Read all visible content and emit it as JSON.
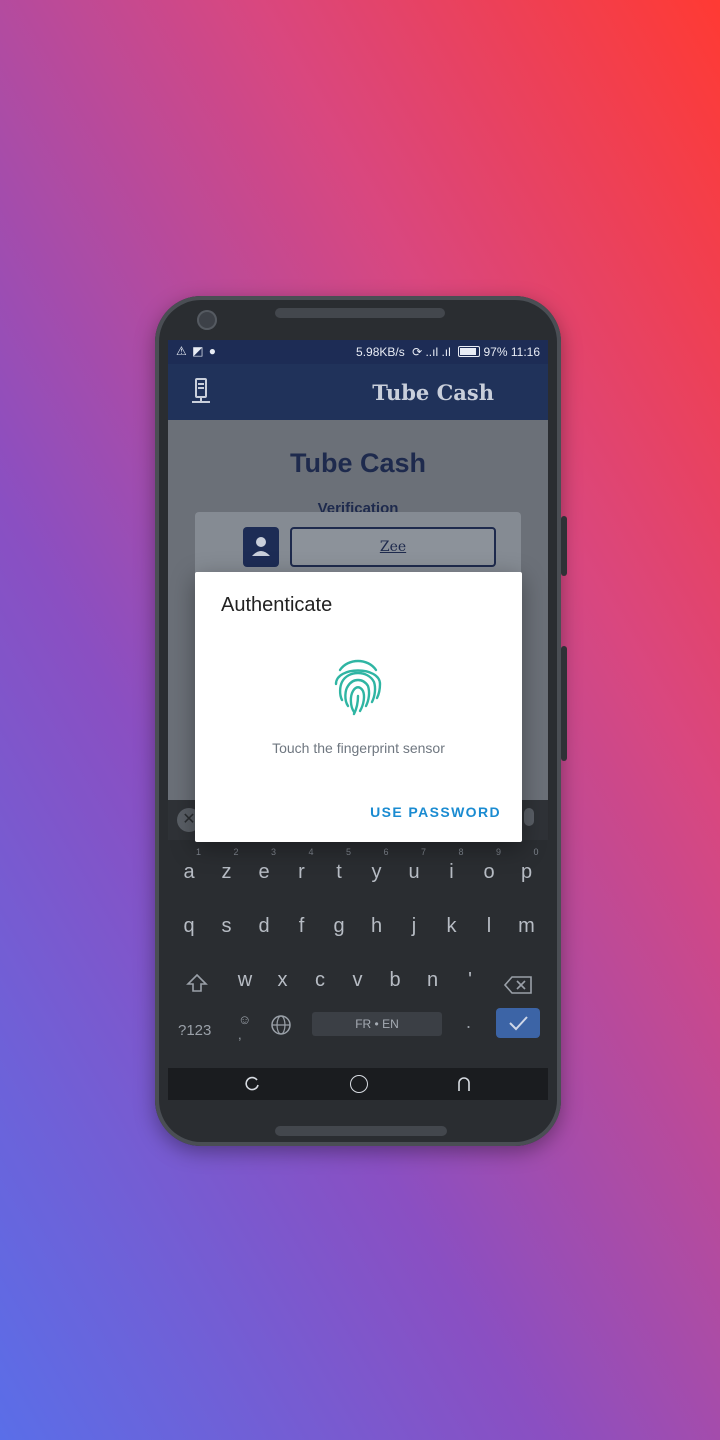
{
  "status_bar": {
    "left_icons": "⚠ ◩ ●",
    "speed": "5.98KB/s",
    "battery": "97%",
    "time": "11:16"
  },
  "app_bar": {
    "title": "Tube Cash",
    "menu_icon": "server-icon"
  },
  "page": {
    "title": "Tube Cash",
    "subtitle": "Verification",
    "username_value": "Zee"
  },
  "dialog": {
    "title": "Authenticate",
    "message": "Touch the fingerprint sensor",
    "button": "USE PASSWORD",
    "accent": "#1a8bd1",
    "fingerprint_color": "#2fb5a3"
  },
  "keyboard": {
    "row1": [
      [
        "a",
        "1"
      ],
      [
        "z",
        "2"
      ],
      [
        "e",
        "3"
      ],
      [
        "r",
        "4"
      ],
      [
        "t",
        "5"
      ],
      [
        "y",
        "6"
      ],
      [
        "u",
        "7"
      ],
      [
        "i",
        "8"
      ],
      [
        "o",
        "9"
      ],
      [
        "p",
        "0"
      ]
    ],
    "row2": [
      "q",
      "s",
      "d",
      "f",
      "g",
      "h",
      "j",
      "k",
      "l",
      "m"
    ],
    "row3": [
      "w",
      "x",
      "c",
      "v",
      "b",
      "n",
      "'"
    ],
    "symbols_label": "?123",
    "space_label": "FR • EN",
    "period_label": "."
  }
}
